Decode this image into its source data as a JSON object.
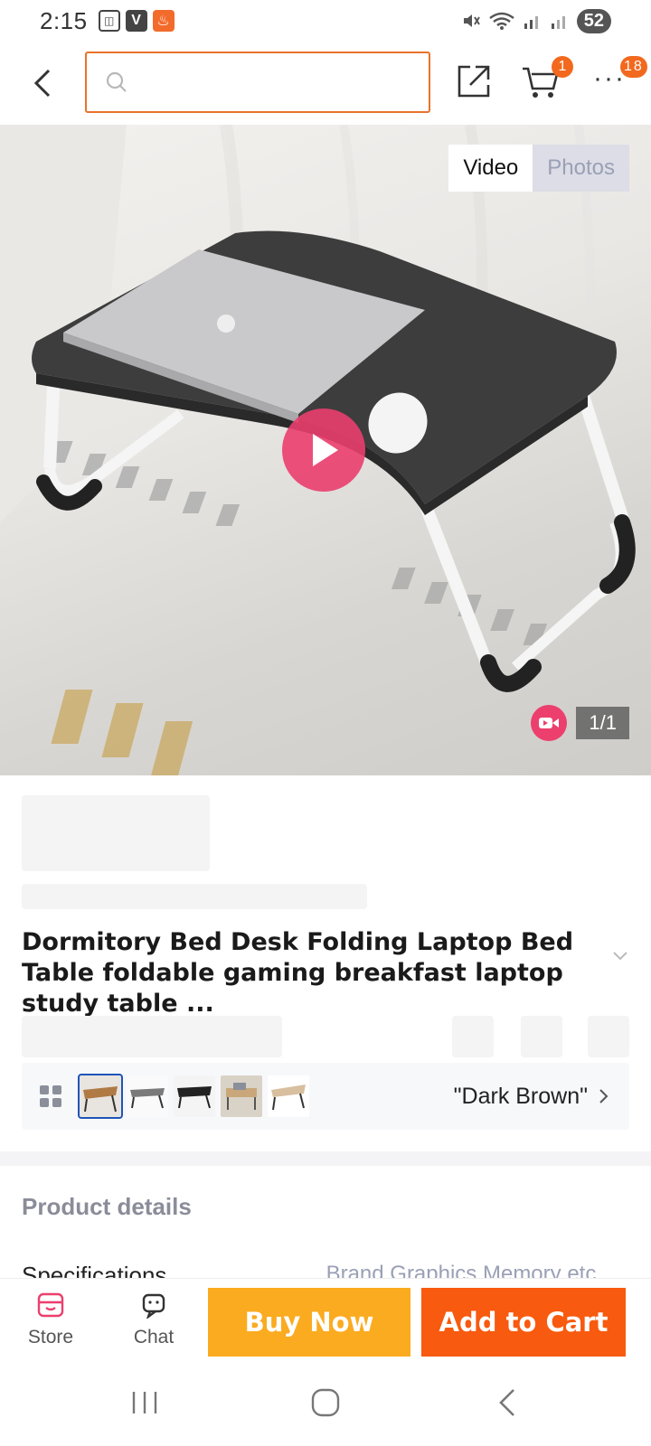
{
  "status_bar": {
    "time": "2:15",
    "battery": "52",
    "left_icons": [
      "screenshot-icon",
      "v-app-icon",
      "flame-app-icon"
    ],
    "right_icons": [
      "mute-icon",
      "wifi-icon",
      "signal-icon",
      "signal-icon"
    ]
  },
  "topnav": {
    "search_placeholder": "",
    "cart_badge": "1",
    "more_badge": "18",
    "more_label": "···"
  },
  "media": {
    "tabs": [
      {
        "label": "Video",
        "active": true
      },
      {
        "label": "Photos",
        "active": false
      }
    ],
    "counter": "1/1"
  },
  "product": {
    "title": "Dormitory Bed Desk Folding Laptop Bed Table foldable gaming breakfast laptop study table ..."
  },
  "variant": {
    "selected_value": "\"Dark Brown\"",
    "thumbnails": [
      "dark-brown",
      "white",
      "black",
      "wood-scene",
      "light-wood"
    ]
  },
  "details": {
    "section_title": "Product details",
    "spec_label": "Specifications",
    "spec_value": "Brand Graphics Memory etc."
  },
  "action_bar": {
    "store_label": "Store",
    "chat_label": "Chat",
    "buy_now_label": "Buy Now",
    "add_to_cart_label": "Add to Cart"
  },
  "colors": {
    "accent_orange": "#f85a0f",
    "buy_now_yellow": "#fbab1f",
    "play_pink": "#ea3e6e",
    "search_border": "#e8732c"
  }
}
